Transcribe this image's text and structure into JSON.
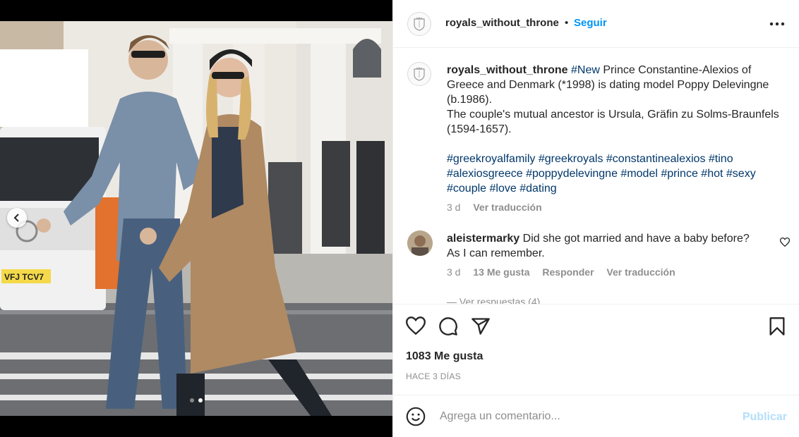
{
  "post": {
    "photo_dots": 2,
    "active_dot": 1
  },
  "header": {
    "username": "royals_without_throne",
    "separator": "•",
    "follow_label": "Seguir"
  },
  "caption": {
    "username": "royals_without_throne",
    "first_tag": "#New",
    "text_line1": " Prince Constantine-Alexios of Greece and Denmark (*1998) is dating model Poppy Delevingne (b.1986).",
    "text_line2": "The couple's mutual ancestor is Ursula, Gräfin zu Solms-Braunfels (1594-1657).",
    "hashtags": [
      "#greekroyalfamily",
      "#greekroyals",
      "#constantinealexios",
      "#tino",
      "#alexiosgreece",
      "#poppydelevingne",
      "#model",
      "#prince",
      "#hot",
      "#sexy",
      "#couple",
      "#love",
      "#dating"
    ],
    "time": "3 d",
    "translate": "Ver traducción"
  },
  "comment": {
    "username": "aleistermarky",
    "text": "Did she got married and have a baby before? As I can remember.",
    "time": "3 d",
    "likes": "13 Me gusta",
    "reply": "Responder",
    "translate": "Ver traducción",
    "cut_off_text": "— Ver respuestas (4)"
  },
  "actions": {
    "likes_count": "1083 Me gusta",
    "posted_ago": "HACE 3 DÍAS"
  },
  "add_comment": {
    "placeholder": "Agrega un comentario...",
    "post_label": "Publicar"
  },
  "colors": {
    "link": "#0095f6",
    "hashtag": "#00376b",
    "muted": "#8e8e8e",
    "publish_disabled": "#b2dffc"
  }
}
